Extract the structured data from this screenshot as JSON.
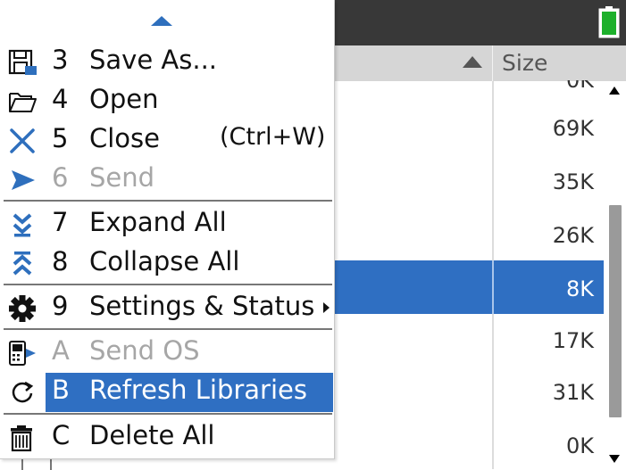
{
  "header": {
    "size_label": "Size"
  },
  "sizes": [
    {
      "value": "0K"
    },
    {
      "value": "69K"
    },
    {
      "value": "35K"
    },
    {
      "value": "26K"
    },
    {
      "value": "8K"
    },
    {
      "value": "17K"
    },
    {
      "value": "31K"
    },
    {
      "value": "0K"
    }
  ],
  "menu": {
    "items": [
      {
        "key": "3",
        "label": "Save As...",
        "icon": "save-as-icon"
      },
      {
        "key": "4",
        "label": "Open",
        "icon": "folder-open-icon"
      },
      {
        "key": "5",
        "label": "Close",
        "shortcut": "(Ctrl+W)",
        "icon": "close-icon"
      },
      {
        "key": "6",
        "label": "Send",
        "icon": "send-icon",
        "disabled": true
      },
      {
        "key": "7",
        "label": "Expand All",
        "icon": "expand-all-icon"
      },
      {
        "key": "8",
        "label": "Collapse All",
        "icon": "collapse-all-icon"
      },
      {
        "key": "9",
        "label": "Settings & Status",
        "icon": "gear-icon",
        "submenu": true
      },
      {
        "key": "A",
        "label": "Send OS",
        "icon": "send-os-icon",
        "disabled": true
      },
      {
        "key": "B",
        "label": "Refresh Libraries",
        "icon": "refresh-icon",
        "highlighted": true
      },
      {
        "key": "C",
        "label": "Delete All",
        "icon": "trash-icon"
      }
    ]
  },
  "colors": {
    "accent": "#2f6fc2",
    "titlebar": "#383838",
    "battery": "#1db02b"
  }
}
